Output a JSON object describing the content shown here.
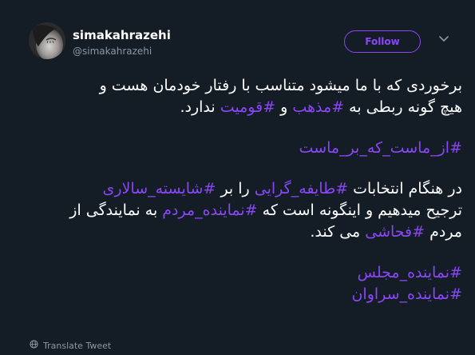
{
  "user": {
    "display_name": "simakahrazehi",
    "handle": "@simakahrazehi"
  },
  "follow_label": "Follow",
  "tweet": {
    "p1": {
      "line1": "برخوردی که با ما میشود متناسب با رفتار خودمان هست و",
      "line2_a": "هیچ گونه ربطی به ",
      "tag_madhab": "#مذهب",
      "line2_b": " و ",
      "tag_qowmiyat": "#قومیت",
      "line2_c": " ندارد."
    },
    "p2": {
      "tag_az_mast": "#از_ماست_که_بر_ماست"
    },
    "p3": {
      "l1_a": "در هنگام انتخابات ",
      "tag_taefe": "#طایفه_گرایی",
      "l1_b": " را بر ",
      "tag_shayeste": "#شایسته_سالاری",
      "l2_a": "ترجیح میدهیم و اینگونه است که ",
      "tag_namayande_mardom": "#نماینده_مردم",
      "l2_b": " به نمایندگی از",
      "l3_a": "مردم ",
      "tag_fahashi": "#فحاشی",
      "l3_b": " می کند."
    },
    "p4": {
      "tag_namayande_majles": "#نماینده_مجلس",
      "tag_namayande_saravan": "#نماینده_سراوان"
    }
  },
  "translate_label": "Translate Tweet",
  "colors": {
    "background": "#141d26",
    "accent": "#8a47f5",
    "muted": "#8899a6",
    "text": "#ffffff"
  },
  "icons": {
    "caret": "chevron-down-icon",
    "translate": "globe-icon"
  }
}
